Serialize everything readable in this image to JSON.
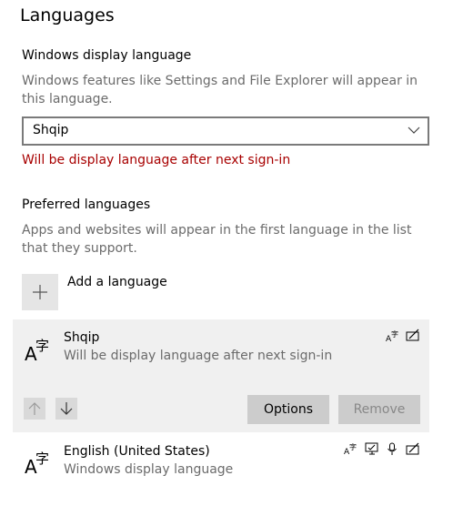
{
  "page": {
    "title": "Languages"
  },
  "display_language": {
    "heading": "Windows display language",
    "description": "Windows features like Settings and File Explorer will appear in this language.",
    "selected": "Shqip",
    "warning": "Will be display language after next sign-in"
  },
  "preferred": {
    "heading": "Preferred languages",
    "description": "Apps and websites will appear in the first language in the list that they support.",
    "add_label": "Add a language",
    "items": [
      {
        "name": "Shqip",
        "subtitle": "Will be display language after next sign-in",
        "selected": true,
        "features": [
          "display-language-icon",
          "handwriting-icon"
        ]
      },
      {
        "name": "English (United States)",
        "subtitle": "Windows display language",
        "selected": false,
        "features": [
          "display-language-icon",
          "windows-display-icon",
          "speech-icon",
          "handwriting-icon"
        ]
      }
    ],
    "buttons": {
      "options": "Options",
      "remove": "Remove"
    }
  },
  "colors": {
    "warning": "#a80000",
    "selected_bg": "#f0f0f0",
    "button_bg": "#cccccc",
    "muted_text": "#6b6b6b"
  }
}
